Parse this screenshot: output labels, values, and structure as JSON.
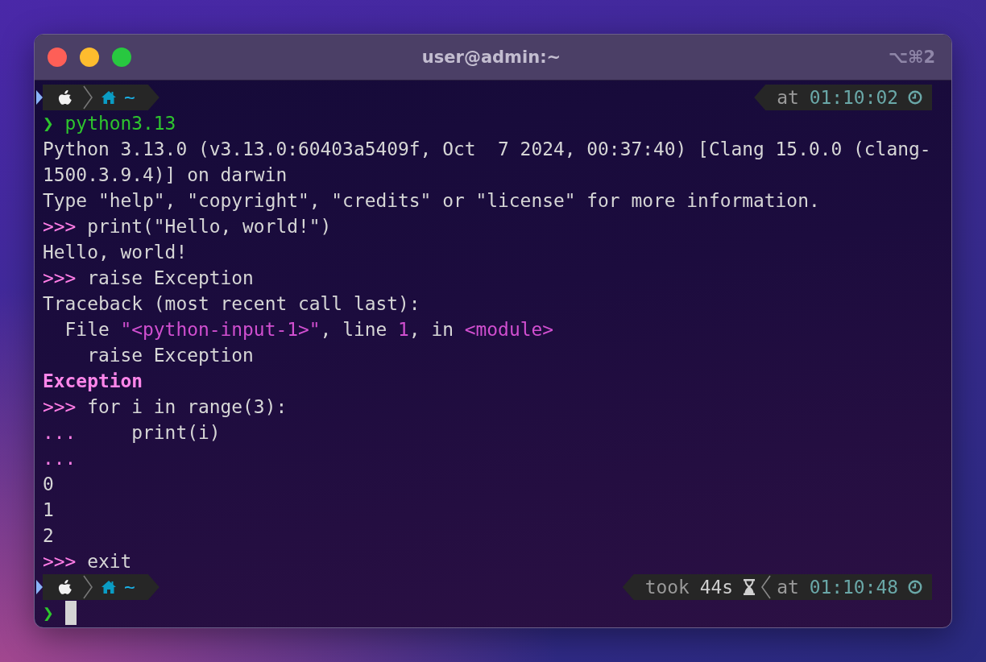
{
  "window": {
    "title": "user@admin:~",
    "shortcut": "⌥⌘2"
  },
  "rows": [
    {
      "kind": "bar",
      "path": "~",
      "right": [
        {
          "kind": "time",
          "label": "at",
          "value": "01:10:02"
        }
      ]
    },
    {
      "kind": "line",
      "segments": [
        {
          "text": "❯ python3.13",
          "kind": "prompt"
        }
      ]
    },
    {
      "kind": "line",
      "segments": [
        {
          "text": "Python 3.13.0 (v3.13.0:60403a5409f, Oct  7 2024, 00:37:40) [Clang 15.0.0 (clang-",
          "kind": "plain"
        }
      ]
    },
    {
      "kind": "line",
      "segments": [
        {
          "text": "1500.3.9.4)] on darwin",
          "kind": "plain"
        }
      ]
    },
    {
      "kind": "line",
      "segments": [
        {
          "text": "Type \"help\", \"copyright\", \"credits\" or \"license\" for more information.",
          "kind": "plain"
        }
      ]
    },
    {
      "kind": "line",
      "segments": [
        {
          "text": ">>> ",
          "kind": "ps"
        },
        {
          "text": "print(\"Hello, world!\")",
          "kind": "plain"
        }
      ]
    },
    {
      "kind": "line",
      "segments": [
        {
          "text": "Hello, world!",
          "kind": "plain"
        }
      ]
    },
    {
      "kind": "line",
      "segments": [
        {
          "text": ">>> ",
          "kind": "ps"
        },
        {
          "text": "raise Exception",
          "kind": "plain"
        }
      ]
    },
    {
      "kind": "line",
      "segments": [
        {
          "text": "Traceback (most recent call last):",
          "kind": "plain"
        }
      ]
    },
    {
      "kind": "line",
      "segments": [
        {
          "text": "  File ",
          "kind": "plain"
        },
        {
          "text": "\"<python-input-1>\"",
          "kind": "accent"
        },
        {
          "text": ", line ",
          "kind": "plain"
        },
        {
          "text": "1",
          "kind": "accent"
        },
        {
          "text": ", in ",
          "kind": "plain"
        },
        {
          "text": "<module>",
          "kind": "accent"
        }
      ]
    },
    {
      "kind": "line",
      "segments": [
        {
          "text": "    raise Exception",
          "kind": "plain"
        }
      ]
    },
    {
      "kind": "line",
      "segments": [
        {
          "text": "Exception",
          "kind": "error"
        }
      ]
    },
    {
      "kind": "line",
      "segments": [
        {
          "text": ">>> ",
          "kind": "ps"
        },
        {
          "text": "for i in range(3):",
          "kind": "plain"
        }
      ]
    },
    {
      "kind": "line",
      "segments": [
        {
          "text": "...",
          "kind": "ps"
        },
        {
          "text": "     print(i)",
          "kind": "plain"
        }
      ]
    },
    {
      "kind": "line",
      "segments": [
        {
          "text": "...",
          "kind": "ps"
        }
      ]
    },
    {
      "kind": "line",
      "segments": [
        {
          "text": "0",
          "kind": "plain"
        }
      ]
    },
    {
      "kind": "line",
      "segments": [
        {
          "text": "1",
          "kind": "plain"
        }
      ]
    },
    {
      "kind": "line",
      "segments": [
        {
          "text": "2",
          "kind": "plain"
        }
      ]
    },
    {
      "kind": "line",
      "segments": [
        {
          "text": ">>> ",
          "kind": "ps"
        },
        {
          "text": "exit",
          "kind": "plain"
        }
      ]
    },
    {
      "kind": "bar",
      "path": "~",
      "right": [
        {
          "kind": "duration",
          "label": "took",
          "value": "44s"
        },
        {
          "kind": "time",
          "label": "at",
          "value": "01:10:48"
        }
      ]
    },
    {
      "kind": "input",
      "prompt": "❯",
      "cursor": true
    }
  ]
}
